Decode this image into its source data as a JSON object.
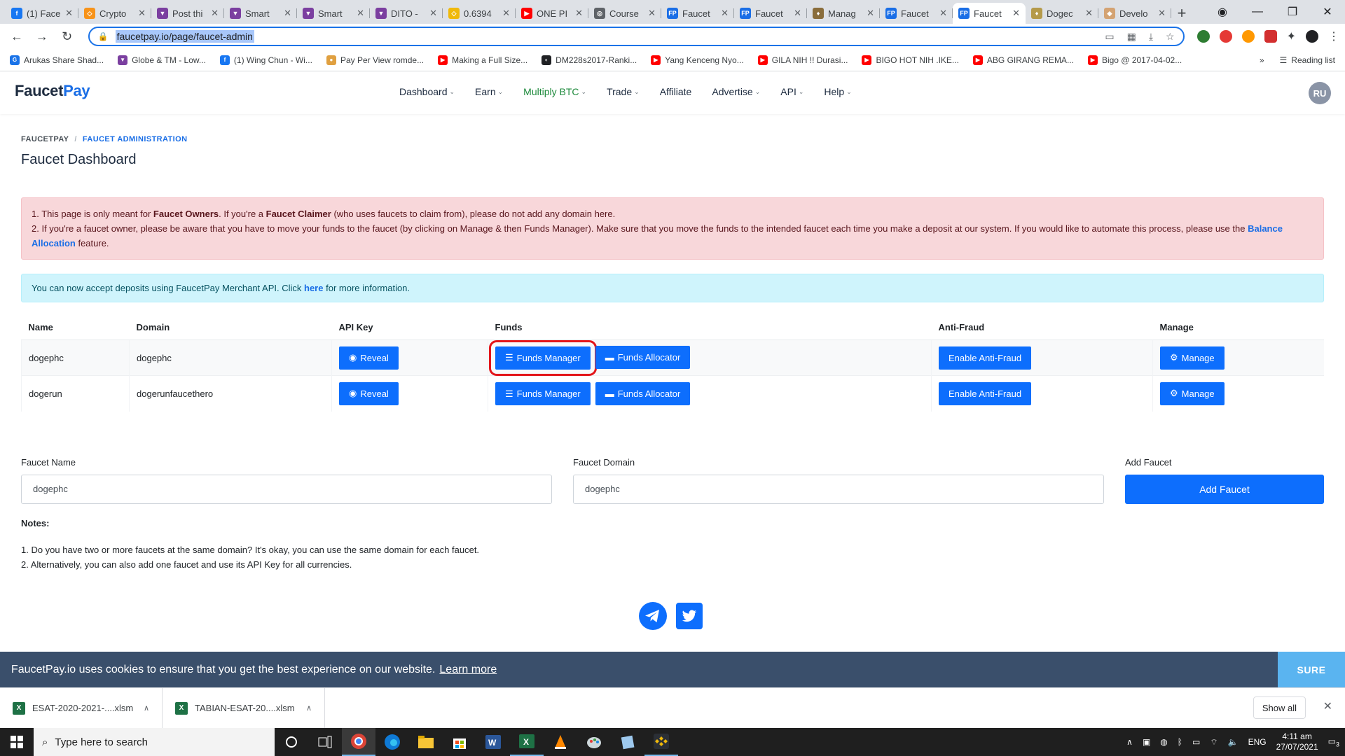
{
  "browser": {
    "tabs": [
      {
        "title": "(1) Face",
        "color": "#1877f2",
        "glyph": "f"
      },
      {
        "title": "Crypto",
        "color": "#f7931a",
        "glyph": "◇"
      },
      {
        "title": "Post thi",
        "color": "#7b3fa0",
        "glyph": "▼"
      },
      {
        "title": "Smart",
        "color": "#7b3fa0",
        "glyph": "▼"
      },
      {
        "title": "Smart",
        "color": "#7b3fa0",
        "glyph": "▼"
      },
      {
        "title": "DITO -",
        "color": "#7b3fa0",
        "glyph": "▼"
      },
      {
        "title": "0.6394",
        "color": "#f0b90b",
        "glyph": "◇"
      },
      {
        "title": "ONE PI",
        "color": "#ff0000",
        "glyph": "▶"
      },
      {
        "title": "Course",
        "color": "#5f6368",
        "glyph": "◎"
      },
      {
        "title": "Faucet",
        "color": "#1a6ee6",
        "glyph": "FP"
      },
      {
        "title": "Faucet",
        "color": "#1a6ee6",
        "glyph": "FP"
      },
      {
        "title": "Manag",
        "color": "#8a6d3b",
        "glyph": "♦"
      },
      {
        "title": "Faucet",
        "color": "#1a6ee6",
        "glyph": "FP"
      },
      {
        "title": "Faucet",
        "color": "#1a6ee6",
        "glyph": "FP",
        "active": true
      },
      {
        "title": "Dogec",
        "color": "#b59a4a",
        "glyph": "♦"
      },
      {
        "title": "Develo",
        "color": "#d4a373",
        "glyph": "◆"
      }
    ],
    "url": "faucetpay.io/page/faucet-admin",
    "bookmarks": [
      {
        "label": "Arukas Share Shad...",
        "color": "#1a73e8",
        "glyph": "G"
      },
      {
        "label": "Globe & TM - Low...",
        "color": "#7b3fa0",
        "glyph": "▼"
      },
      {
        "label": "(1) Wing Chun - Wi...",
        "color": "#1877f2",
        "glyph": "f"
      },
      {
        "label": "Pay Per View romde...",
        "color": "#e0a040",
        "glyph": "●"
      },
      {
        "label": "Making a Full Size...",
        "color": "#ff0000",
        "glyph": "▶"
      },
      {
        "label": "DM228s2017-Ranki...",
        "color": "#202124",
        "glyph": "◐"
      },
      {
        "label": "Yang Kenceng Nyo...",
        "color": "#ff0000",
        "glyph": "▶"
      },
      {
        "label": "GILA NIH !! Durasi...",
        "color": "#ff0000",
        "glyph": "▶"
      },
      {
        "label": "BIGO HOT NIH .IKE...",
        "color": "#ff0000",
        "glyph": "▶"
      },
      {
        "label": "ABG GIRANG REMA...",
        "color": "#ff0000",
        "glyph": "▶"
      },
      {
        "label": "Bigo @ 2017-04-02...",
        "color": "#ff0000",
        "glyph": "▶"
      }
    ],
    "more_bookmarks": "»",
    "reading_list": "Reading list"
  },
  "site": {
    "logo_part1": "Faucet",
    "logo_part2": "Pay",
    "menu": [
      {
        "label": "Dashboard",
        "caret": true
      },
      {
        "label": "Earn",
        "caret": true
      },
      {
        "label": "Multiply BTC",
        "caret": true,
        "green": true
      },
      {
        "label": "Trade",
        "caret": true
      },
      {
        "label": "Affiliate",
        "caret": false
      },
      {
        "label": "Advertise",
        "caret": true
      },
      {
        "label": "API",
        "caret": true
      },
      {
        "label": "Help",
        "caret": true
      }
    ],
    "avatar": "RU"
  },
  "breadcrumb": {
    "root": "FAUCETPAY",
    "sep": "/",
    "current": "FAUCET ADMINISTRATION"
  },
  "page_title": "Faucet Dashboard",
  "alert_danger": {
    "l1_a": "1. This page is only meant for ",
    "l1_b": "Faucet Owners",
    "l1_c": ". If you're a ",
    "l1_d": "Faucet Claimer",
    "l1_e": " (who uses faucets to claim from), please do not add any domain here.",
    "l2_a": "2. If you're a faucet owner, please be aware that you have to move your funds to the faucet (by clicking on Manage & then Funds Manager). Make sure that you move the funds to the intended faucet each time you make a deposit at our system. If you would like to automate this process, please use the ",
    "l2_link": "Balance Allocation",
    "l2_b": " feature."
  },
  "alert_info": {
    "a": "You can now accept deposits using FaucetPay Merchant API. Click ",
    "link": "here",
    "b": " for more information."
  },
  "table": {
    "headers": [
      "Name",
      "Domain",
      "API Key",
      "Funds",
      "Anti-Fraud",
      "Manage"
    ],
    "rows": [
      {
        "name": "dogephc",
        "domain": "dogephc",
        "reveal": "Reveal",
        "funds_manager": "Funds Manager",
        "funds_allocator": "Funds Allocator",
        "anti_fraud": "Enable Anti-Fraud",
        "manage": "Manage"
      },
      {
        "name": "dogerun",
        "domain": "dogerunfaucethero",
        "reveal": "Reveal",
        "funds_manager": "Funds Manager",
        "funds_allocator": "Funds Allocator",
        "anti_fraud": "Enable Anti-Fraud",
        "manage": "Manage"
      }
    ]
  },
  "form": {
    "name_label": "Faucet Name",
    "name_value": "dogephc",
    "domain_label": "Faucet Domain",
    "domain_value": "dogephc",
    "add_label": "Add Faucet",
    "add_button": "Add Faucet"
  },
  "notes": {
    "title": "Notes:",
    "items": [
      "1. Do you have two or more faucets at the same domain? It's okay, you can use the same domain for each faucet.",
      "2. Alternatively, you can also add one faucet and use its API Key for all currencies."
    ]
  },
  "cookie": {
    "text": "FaucetPay.io uses cookies to ensure that you get the best experience on our website.",
    "link": "Learn more",
    "button": "SURE"
  },
  "downloads": {
    "items": [
      "ESAT-2020-2021-....xlsm",
      "TABIAN-ESAT-20....xlsm"
    ],
    "show_all": "Show all"
  },
  "taskbar": {
    "search_placeholder": "Type here to search",
    "lang": "ENG",
    "time": "4:11 am",
    "date": "27/07/2021",
    "notifications": "3"
  },
  "colors": {
    "primary": "#0d6efd",
    "highlight": "#e3161b",
    "brand_blue": "#1a6ee6"
  }
}
